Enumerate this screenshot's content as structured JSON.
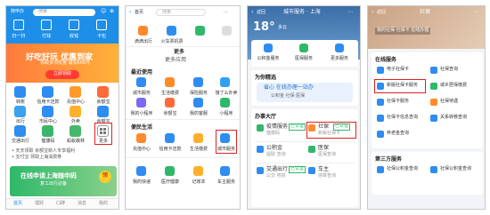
{
  "colors": {
    "blue": "#1e8fe8",
    "red": "#e02020",
    "orange": "#ff8a2a"
  },
  "phone1": {
    "location": "随申办",
    "search_placeholder": "搜索",
    "top_icons": [
      "扫一扫",
      "付钱",
      "收钱",
      "卡包"
    ],
    "banner_title": "好吃好玩 优惠到家",
    "banner_sub": "领取多项优惠 最高666元",
    "banner_btn": "立即领取",
    "grid": [
      "转账",
      "信用卡还款",
      "充值中心",
      "余额宝",
      "余额宝",
      "出行",
      "市民中心",
      "外卖",
      "交通出行",
      "健康码",
      "蚂蚁森林",
      "更多"
    ],
    "promo1": "• 天天领取 余额宝新人专享福利",
    "promo2": "• 支付宝 领取上海消费券",
    "ad_title": "在线申请上海随申码",
    "ad_sub": "复工出行必备",
    "ad_badge": "领",
    "tabs": [
      "首页",
      "理财",
      "口碑",
      "消息",
      "我的"
    ]
  },
  "phone2": {
    "back": "首页",
    "search_placeholder": "搜索",
    "top_icons": [
      "滴滴出行",
      "火车票机票",
      "",
      ""
    ],
    "more_title": "更多",
    "more_apps": "更多应用",
    "recent_title": "最近使用",
    "recent": [
      "城市服务",
      "生活缴费",
      "保险服务",
      "饿了么外卖"
    ],
    "recent2": [
      "我的小程序",
      "余额宝",
      "我的客服",
      "小程序"
    ],
    "life_title": "便民生活",
    "life": [
      "充值中心",
      "信用卡还款",
      "生活缴费",
      "城市服务"
    ],
    "bottom": [
      "我的快递",
      "医疗健康",
      "记账本",
      "车主服务"
    ]
  },
  "phone3": {
    "back": "返回",
    "title": "城市服务 · 上海",
    "temp": "18°",
    "weather": "多云",
    "quick": [
      "公积金服务",
      "医保服务",
      "更多服务"
    ],
    "recommend_title": "为你精选",
    "recommend": "省心 在线办理一站办",
    "recommend_sub": "公积金 社保 医保",
    "do_title": "办事大厅",
    "services": [
      {
        "name": "疫情服务",
        "sub": "健康码",
        "badge": "已认证"
      },
      {
        "name": "社保",
        "sub": "新版社保卡",
        "badge": "已认证"
      },
      {
        "name": "公积金",
        "sub": "提取 查询",
        "badge": ""
      },
      {
        "name": "医保",
        "sub": "医保查询",
        "badge": ""
      },
      {
        "name": "交通出行",
        "sub": "公交 地铁",
        "badge": "已认证"
      },
      {
        "name": "车主",
        "sub": "违章查询",
        "badge": ""
      }
    ]
  },
  "phone4": {
    "back": "返回",
    "title": "社保",
    "banner_text": "我的社保 社保卡 在线办理",
    "online_title": "在线服务",
    "online": [
      "电子社保卡",
      "社保查询",
      "新版社保卡服务",
      "城乡居保缴费",
      "社保卡服务",
      "社保待遇",
      "社保卡信息查询",
      "关系转移查询",
      "养老金查询"
    ],
    "third_title": "第三方服务",
    "third": [
      "社保公积金查询",
      "社保公积金查询"
    ]
  }
}
